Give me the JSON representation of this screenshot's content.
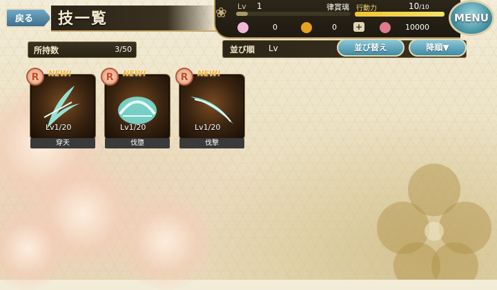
{
  "header": {
    "back_label": "戻る",
    "page_title": "技一覧"
  },
  "status": {
    "lv_label": "Lv",
    "lv_value": "1",
    "player_name": "律賞璃",
    "stamina_label": "行動力",
    "stamina_current": "10",
    "stamina_max": "/10",
    "stamina_fraction": 1.0,
    "currencies": [
      {
        "icon": "sakura-gem-icon",
        "value": "0",
        "color": "#f0b8d8"
      },
      {
        "icon": "gold-coin-icon",
        "value": "0",
        "color": "#e8a020"
      },
      {
        "icon": "plus-icon",
        "value": "",
        "color": "#e0d6b0"
      },
      {
        "icon": "flower-token-icon",
        "value": "10000",
        "color": "#e07a8a"
      }
    ],
    "menu_label": "MENU"
  },
  "controls": {
    "owned_label": "所持数",
    "owned_value": "3/50",
    "sort_label": "並び順",
    "sort_value": "Lv",
    "sort_button": "並び替え",
    "order_button": "降順▼"
  },
  "skills": [
    {
      "rank": "R",
      "new": "NEW!",
      "level": "Lv1/20",
      "name": "穿天",
      "icon": "wind-feather-icon"
    },
    {
      "rank": "R",
      "new": "NEW!",
      "level": "Lv1/20",
      "name": "伐墮",
      "icon": "cyan-burst-icon"
    },
    {
      "rank": "R",
      "new": "NEW!",
      "level": "Lv1/20",
      "name": "伐撃",
      "icon": "crescent-slash-icon"
    }
  ]
}
